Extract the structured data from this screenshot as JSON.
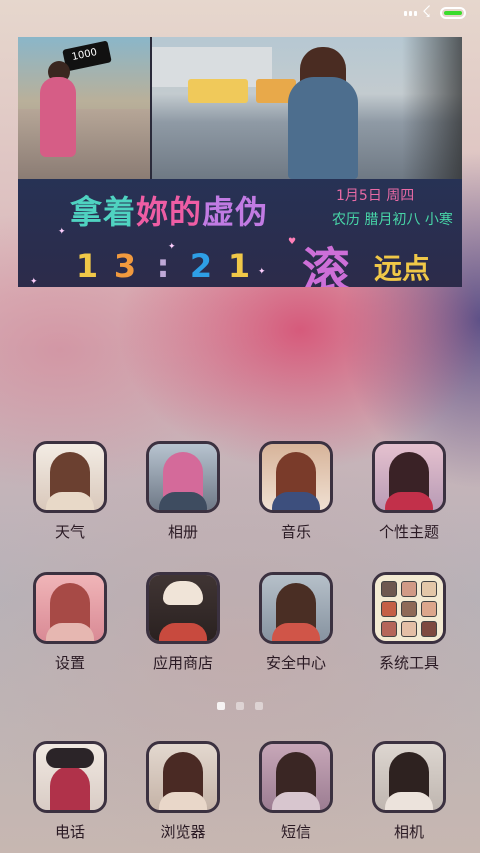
{
  "status_bar": {
    "icons": [
      "signal-icon",
      "charging-icon",
      "battery-icon"
    ],
    "battery_color": "#3bdc2d"
  },
  "widget": {
    "headline_part1": "拿着",
    "headline_part2": "妳的",
    "headline_part3": "虚伪",
    "date": "1月5日 周四",
    "lunar": "农历 腊月初八 小寒",
    "time_digits": [
      "1",
      "3",
      ":",
      "2",
      "1"
    ],
    "slogan_big": "滚",
    "slogan_small": "远点",
    "sign_text": "1000"
  },
  "apps": [
    {
      "id": "weather",
      "label": "天气"
    },
    {
      "id": "gallery",
      "label": "相册"
    },
    {
      "id": "music",
      "label": "音乐"
    },
    {
      "id": "themes",
      "label": "个性主题"
    },
    {
      "id": "settings",
      "label": "设置"
    },
    {
      "id": "app-store",
      "label": "应用商店"
    },
    {
      "id": "security",
      "label": "安全中心"
    },
    {
      "id": "tools",
      "label": "系统工具"
    }
  ],
  "dock": [
    {
      "id": "phone",
      "label": "电话"
    },
    {
      "id": "browser",
      "label": "浏览器"
    },
    {
      "id": "messages",
      "label": "短信"
    },
    {
      "id": "camera",
      "label": "相机"
    }
  ],
  "page_indicator": {
    "pages": 3,
    "current": 1
  }
}
